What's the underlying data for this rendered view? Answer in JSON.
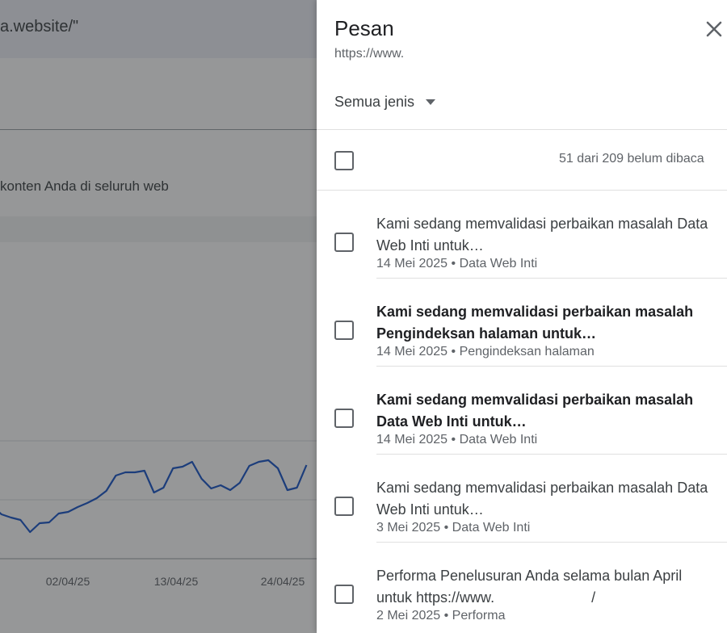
{
  "background": {
    "url_fragment": "a.website/\"",
    "description_fragment": "konten Anda di seluruh web",
    "chart_data": {
      "type": "line",
      "x_tick_labels": [
        "02/04/25",
        "13/04/25",
        "24/04/25"
      ],
      "values": [
        66,
        55,
        51,
        48,
        33,
        44,
        45,
        56,
        58,
        64,
        69,
        75,
        84,
        103,
        107,
        107,
        109,
        82,
        88,
        112,
        114,
        120,
        99,
        87,
        91,
        85,
        94,
        115,
        120,
        122,
        112,
        85,
        88,
        116
      ],
      "color": "#1a56c8",
      "grid": true
    }
  },
  "panel": {
    "title": "Pesan",
    "subtitle": "https://www.",
    "filter": {
      "selected": "Semua jenis"
    },
    "summary": "51 dari 209 belum dibaca",
    "messages": [
      {
        "title": "Kami sedang memvalidasi perbaikan masalah Data Web Inti untuk…",
        "date": "14 Mei 2025",
        "category": "Data Web Inti",
        "unread": false
      },
      {
        "title": "Kami sedang memvalidasi perbaikan masalah Pengindeksan halaman untuk…",
        "date": "14 Mei 2025",
        "category": "Pengindeksan halaman",
        "unread": true
      },
      {
        "title": "Kami sedang memvalidasi perbaikan masalah Data Web Inti untuk…",
        "date": "14 Mei 2025",
        "category": "Data Web Inti",
        "unread": true
      },
      {
        "title": "Kami sedang memvalidasi perbaikan masalah Data Web Inti untuk…",
        "date": "3 Mei 2025",
        "category": "Data Web Inti",
        "unread": false
      },
      {
        "title": "Performa Penelusuran Anda selama bulan April untuk https://www.                        /",
        "date": "2 Mei 2025",
        "category": "Performa",
        "unread": false
      }
    ],
    "meta_separator": " • "
  },
  "icons": {
    "close": "close-icon",
    "dropdown": "arrow-drop-down-icon"
  }
}
